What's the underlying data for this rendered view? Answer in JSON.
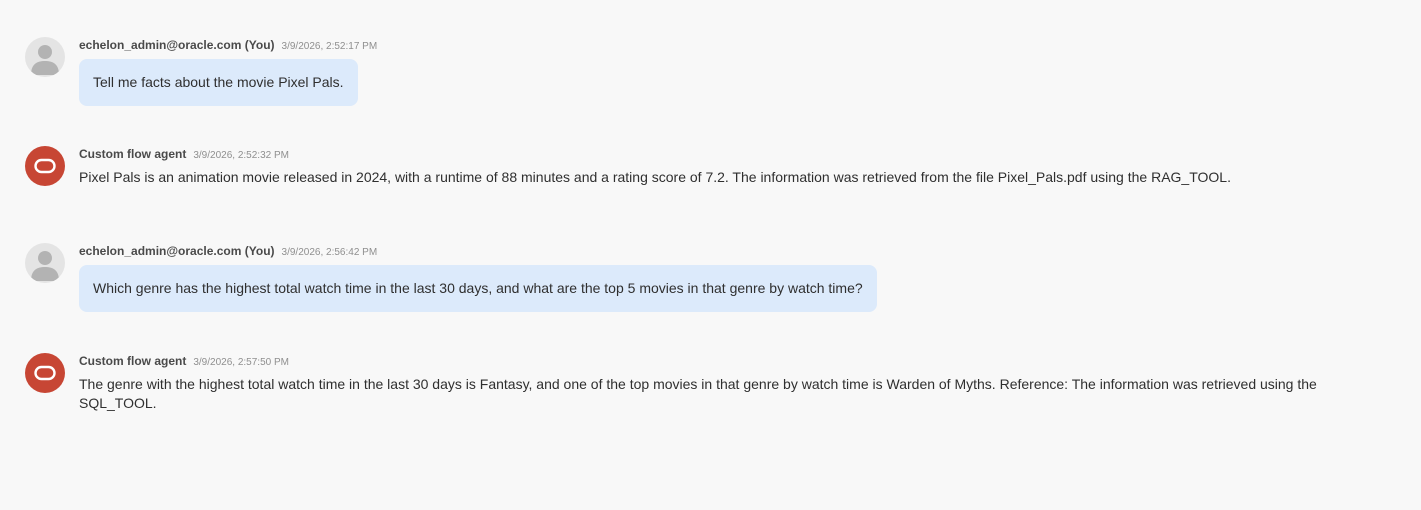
{
  "messages": [
    {
      "role": "user",
      "sender": "echelon_admin@oracle.com (You)",
      "time": "3/9/2026, 2:52:17 PM",
      "text": "Tell me facts about the movie Pixel Pals.",
      "avatar_icon": "user-avatar-icon"
    },
    {
      "role": "agent",
      "sender": "Custom flow agent",
      "time": "3/9/2026, 2:52:32 PM",
      "text": "Pixel Pals is an animation movie released in 2024, with a runtime of 88 minutes and a rating score of 7.2. The information was retrieved from the file Pixel_Pals.pdf using the RAG_TOOL.",
      "avatar_icon": "oracle-logo-icon"
    },
    {
      "role": "user",
      "sender": "echelon_admin@oracle.com (You)",
      "time": "3/9/2026, 2:56:42 PM",
      "text": "Which genre has the highest total watch time in the last 30 days, and what are the top 5 movies in that genre by watch time?",
      "avatar_icon": "user-avatar-icon"
    },
    {
      "role": "agent",
      "sender": "Custom flow agent",
      "time": "3/9/2026, 2:57:50 PM",
      "text": "The genre with the highest total watch time in the last 30 days is Fantasy, and one of the top movies in that genre by watch time is Warden of Myths. Reference: The information was retrieved using the SQL_TOOL.",
      "avatar_icon": "oracle-logo-icon"
    }
  ],
  "colors": {
    "background": "#f8f8f8",
    "user_bubble": "#dceafb",
    "agent_avatar": "#c74634",
    "user_avatar": "#e4e4e4"
  }
}
